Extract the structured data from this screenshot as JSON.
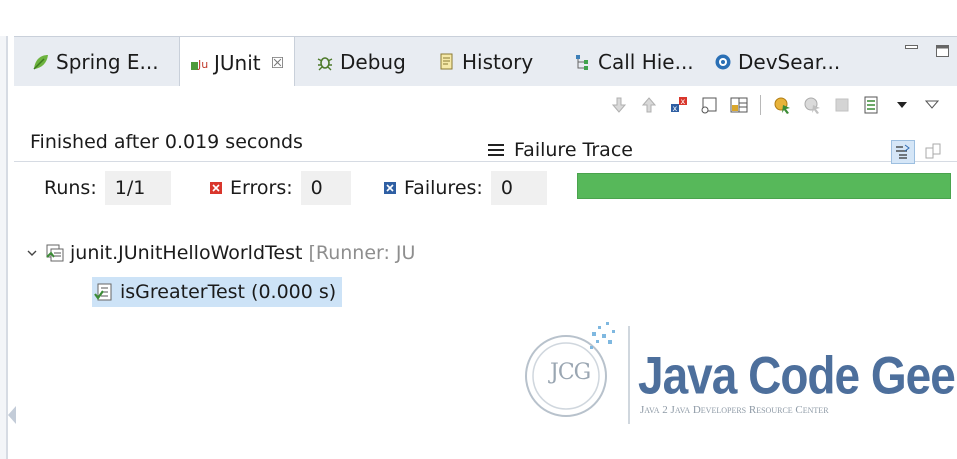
{
  "tabs": [
    {
      "label": "Spring E...",
      "icon": "leaf-icon"
    },
    {
      "label": "JUnit",
      "icon": "junit-icon",
      "active": true,
      "close": "☒"
    },
    {
      "label": "Debug",
      "icon": "bug-icon"
    },
    {
      "label": "History",
      "icon": "history-icon"
    },
    {
      "label": "Call Hie...",
      "icon": "call-hierarchy-icon"
    },
    {
      "label": "DevSear...",
      "icon": "devsearch-icon"
    }
  ],
  "status": {
    "finished": "Finished after 0.019 seconds"
  },
  "counters": {
    "runs_label": "Runs:",
    "runs_value": "1/1",
    "errors_label": "Errors:",
    "errors_value": "0",
    "failures_label": "Failures:",
    "failures_value": "0"
  },
  "progress": {
    "fraction": 1.0,
    "color": "#57b85a"
  },
  "tree": {
    "suite_name": "junit.JUnitHelloWorldTest",
    "suite_runner": "[Runner: JU",
    "test_name": "isGreaterTest (0.000 s)"
  },
  "trace": {
    "title": "Failure Trace"
  },
  "logo": {
    "text_main": "Java Code Geeks",
    "text_sub": "Java 2 Java Developers Resource Center",
    "badge": "JCG"
  }
}
